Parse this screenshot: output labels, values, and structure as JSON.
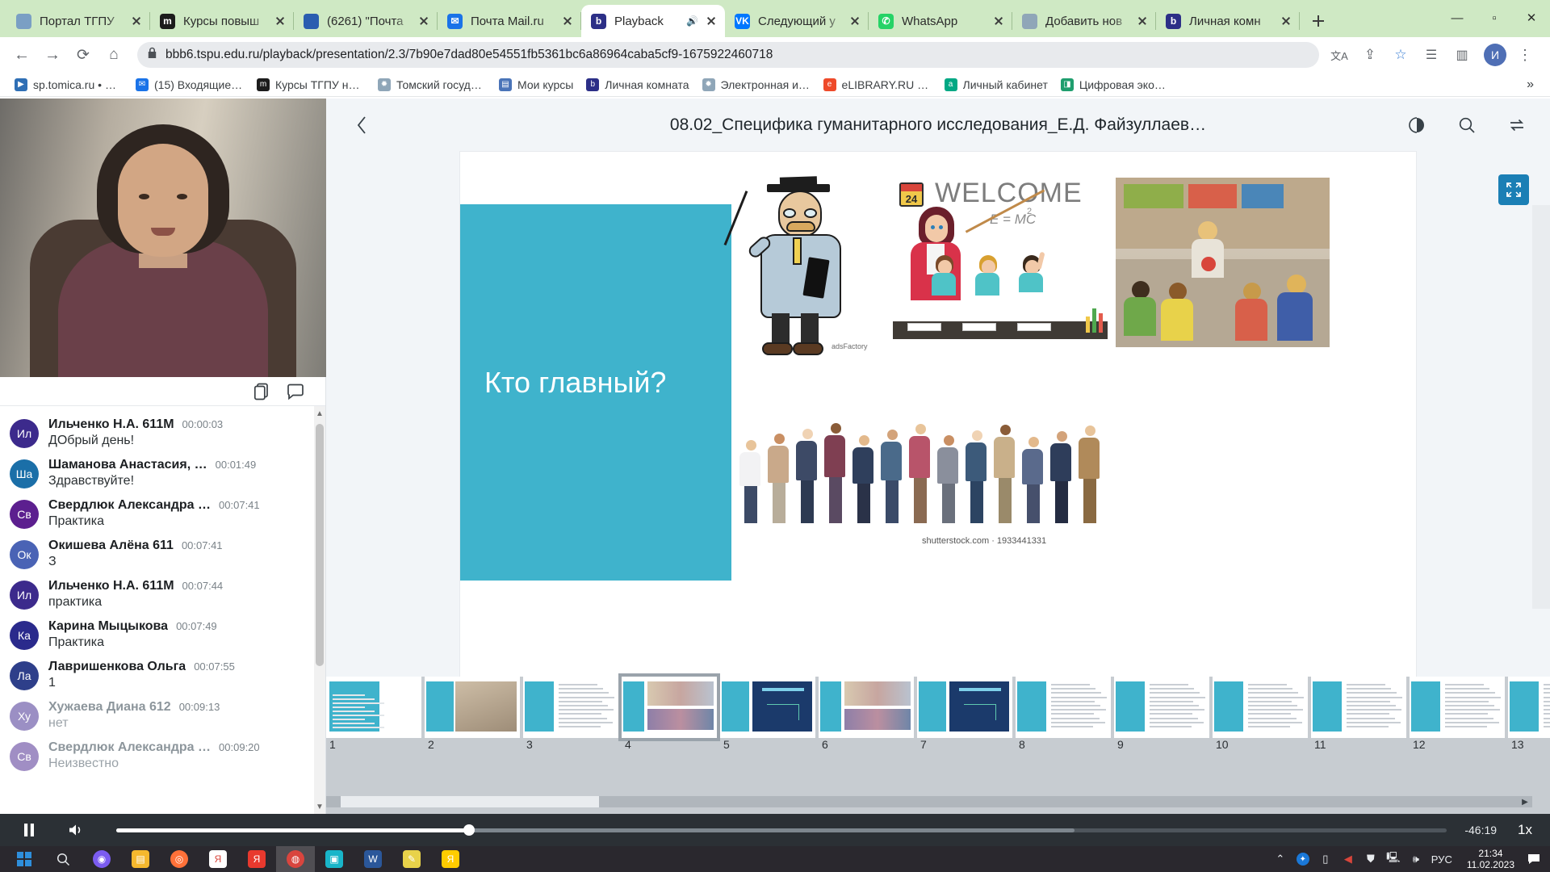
{
  "browser": {
    "tabs": [
      {
        "title": "Портал ТГПУ",
        "icon": "tspu-icon",
        "fav_color": "#7a9fc4",
        "fav_text": "",
        "active": false,
        "audio": false
      },
      {
        "title": "Курсы повыш",
        "icon": "moodle-icon",
        "fav_color": "#1c1c1c",
        "fav_text": "m",
        "active": false,
        "audio": false
      },
      {
        "title": "(6261) \"Почта",
        "icon": "mailru-icon",
        "fav_color": "#2a5db0",
        "fav_text": "",
        "active": false,
        "audio": false
      },
      {
        "title": "Почта Mail.ru",
        "icon": "mail-icon",
        "fav_color": "#1a73e8",
        "fav_text": "✉",
        "active": false,
        "audio": false
      },
      {
        "title": "Playback",
        "icon": "bigbluebutton-icon",
        "fav_color": "#2c2f87",
        "fav_text": "b",
        "active": true,
        "audio": true
      },
      {
        "title": "Следующий у",
        "icon": "vk-icon",
        "fav_color": "#0077ff",
        "fav_text": "VK",
        "active": false,
        "audio": false
      },
      {
        "title": "WhatsApp",
        "icon": "whatsapp-icon",
        "fav_color": "#25d366",
        "fav_text": "✆",
        "active": false,
        "audio": false
      },
      {
        "title": "Добавить нов",
        "icon": "globe-icon",
        "fav_color": "#8fa6b8",
        "fav_text": "",
        "active": false,
        "audio": false
      },
      {
        "title": "Личная комн",
        "icon": "bigbluebutton-icon",
        "fav_color": "#2c2f87",
        "fav_text": "b",
        "active": false,
        "audio": false
      }
    ],
    "new_tab_label": "+",
    "window_controls": {
      "minimize": "—",
      "maximize": "▫",
      "close": "✕"
    },
    "nav": {
      "back": "←",
      "forward": "→",
      "reload": "⟳",
      "home": "⌂"
    },
    "address": {
      "lock_icon": "lock-icon",
      "url": "bbb6.tspu.edu.ru/playback/presentation/2.3/7b90e7dad80e54551fb5361bc6a86964caba5cf9-1675922460718"
    },
    "nav_end": {
      "translate": "translate-icon",
      "share": "share-icon",
      "bookmark_star": "star-icon",
      "reading_list": "reading-list-icon",
      "side_panel": "side-panel-icon",
      "profile_initial": "И",
      "menu": "⋮"
    },
    "bookmarks": [
      {
        "label": "sp.tomica.ru • Ката…",
        "fav_color": "#2f6fb5",
        "fav_text": "▶"
      },
      {
        "label": "(15) Входящие - П…",
        "fav_color": "#1a73e8",
        "fav_text": "✉"
      },
      {
        "label": "Курсы ТГПУ на пла…",
        "fav_color": "#1c1c1c",
        "fav_text": "m"
      },
      {
        "label": "Томский государст…",
        "fav_color": "#8fa6b8",
        "fav_text": "✹"
      },
      {
        "label": "Мои курсы",
        "fav_color": "#4a74b8",
        "fav_text": "▤"
      },
      {
        "label": "Личная комната",
        "fav_color": "#2c2f87",
        "fav_text": "b"
      },
      {
        "label": "Электронная инфо…",
        "fav_color": "#8fa6b8",
        "fav_text": "✹"
      },
      {
        "label": "eLIBRARY.RU - НАУ…",
        "fav_color": "#ee4a2a",
        "fav_text": "e"
      },
      {
        "label": "Личный кабинет",
        "fav_color": "#00a884",
        "fav_text": "a"
      },
      {
        "label": "Цифровая экосист…",
        "fav_color": "#1f9e6e",
        "fav_text": "◨"
      }
    ],
    "bookmarks_overflow": "»"
  },
  "playback": {
    "back_icon": "chevron-left-icon",
    "title": "08.02_Специфика гуманитарного исследования_Е.Д. Файзуллаев…",
    "header_actions": [
      {
        "name": "theme-toggle-icon",
        "glyph": "◐"
      },
      {
        "name": "search-icon",
        "glyph": "⌕"
      },
      {
        "name": "swap-layout-icon",
        "glyph": "⇄"
      }
    ],
    "fullscreen_icon": "fullscreen-icon",
    "fullscreen_color": "#1b7fb5",
    "webcam": {
      "name": "presenter-webcam"
    },
    "cam_actions": [
      {
        "name": "notes-icon",
        "glyph": "🗐"
      },
      {
        "name": "chat-icon",
        "glyph": "🗨"
      }
    ],
    "chat": [
      {
        "initials": "Ил",
        "color": "#3c2a8c",
        "who": "Ильченко Н.А. 611М",
        "time": "00:00:03",
        "text": "ДОбрый день!",
        "dim": false
      },
      {
        "initials": "Ша",
        "color": "#1b6fa8",
        "who": "Шаманова Анастасия, …",
        "time": "00:01:49",
        "text": "Здравствуйте!",
        "dim": false
      },
      {
        "initials": "Св",
        "color": "#5c1f8f",
        "who": "Свердлюк Александра …",
        "time": "00:07:41",
        "text": "Практика",
        "dim": false
      },
      {
        "initials": "Ок",
        "color": "#4a63b5",
        "who": "Окишева Алёна 611",
        "time": "00:07:41",
        "text": "З",
        "dim": false
      },
      {
        "initials": "Ил",
        "color": "#3c2a8c",
        "who": "Ильченко Н.А. 611М",
        "time": "00:07:44",
        "text": "практика",
        "dim": false
      },
      {
        "initials": "Ка",
        "color": "#2a2a8c",
        "who": "Карина Мыцыкова",
        "time": "00:07:49",
        "text": "Практика",
        "dim": false
      },
      {
        "initials": "Ла",
        "color": "#2e3f8a",
        "who": "Лавришенкова Ольга",
        "time": "00:07:55",
        "text": "1",
        "dim": false
      },
      {
        "initials": "Ху",
        "color": "#9b8fc4",
        "who": "Хужаева Диана 612",
        "time": "00:09:13",
        "text": "нет",
        "dim": true
      },
      {
        "initials": "Св",
        "color": "#a08ec4",
        "who": "Свердлюк Александра …",
        "time": "00:09:20",
        "text": "Неизвестно",
        "dim": true
      }
    ],
    "slide": {
      "title_block_text": "Кто главный?",
      "accent_color": "#3fb3cc",
      "welcome_text": "WELCOME",
      "formula_text": "E = MC",
      "formula_exp": "2",
      "calendar_day": "24",
      "watermark": "adsFactory",
      "stock_caption": "shutterstock.com · 1933441331"
    },
    "thumbnails": {
      "numbers": [
        "1",
        "2",
        "3",
        "4",
        "5",
        "6",
        "7",
        "8",
        "9",
        "10",
        "11",
        "12",
        "13"
      ],
      "selected": 4,
      "scroll_left": "◀",
      "scroll_right": "▶"
    },
    "player": {
      "play_pause_icon": "pause-icon",
      "volume_icon": "volume-icon",
      "time_remaining": "-46:19",
      "speed": "1x",
      "progress_percent": 26.5,
      "buffered_percent": 72
    }
  },
  "taskbar": {
    "start_icon": "windows-start-icon",
    "search_icon": "search-icon",
    "apps": [
      {
        "name": "cortana-icon",
        "color": "#7b5cf0",
        "glyph": "◉"
      },
      {
        "name": "file-explorer-icon",
        "color": "#f5b82e",
        "glyph": "▤"
      },
      {
        "name": "firefox-icon",
        "color": "#ff7139",
        "glyph": "◎"
      },
      {
        "name": "yandex-browser-icon",
        "color": "#ffffff",
        "glyph": "Я"
      },
      {
        "name": "yandex-icon",
        "color": "#e8392e",
        "glyph": "Я"
      },
      {
        "name": "chrome-icon",
        "color": "#d9453e",
        "glyph": "◍"
      },
      {
        "name": "app-icon",
        "color": "#19b5c9",
        "glyph": "▣"
      },
      {
        "name": "word-icon",
        "color": "#2b579a",
        "glyph": "W"
      },
      {
        "name": "paint-icon",
        "color": "#e8d24a",
        "glyph": "✎"
      },
      {
        "name": "yandex-music-icon",
        "color": "#ffcc00",
        "glyph": "Я"
      }
    ],
    "tray": [
      {
        "name": "show-hidden-icons",
        "glyph": "⌃"
      },
      {
        "name": "bluetooth-icon",
        "glyph": "✦"
      },
      {
        "name": "usb-icon",
        "glyph": "▯"
      },
      {
        "name": "sound-red-icon",
        "glyph": "◀"
      },
      {
        "name": "defender-icon",
        "glyph": "⛊"
      },
      {
        "name": "network-icon",
        "glyph": "🖳"
      },
      {
        "name": "speaker-icon",
        "glyph": "🕪"
      }
    ],
    "language": "РУС",
    "time": "21:34",
    "date": "11.02.2023",
    "notification_icon": "notification-icon"
  }
}
